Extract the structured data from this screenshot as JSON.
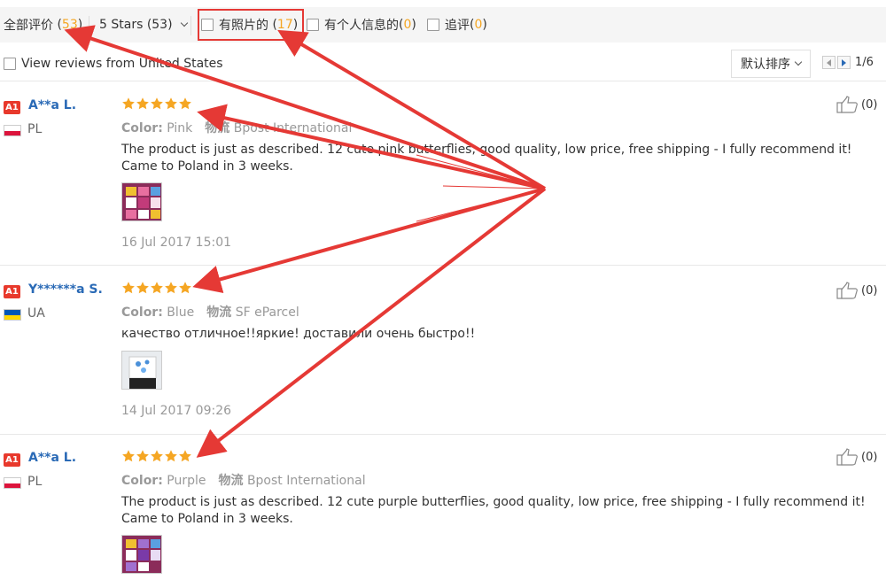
{
  "filters": {
    "all_label": "全部评价",
    "all_count": "53",
    "stars_label": "5 Stars (53)",
    "photo_label": "有照片的",
    "photo_count": "17",
    "personal_label": "有个人信息的",
    "personal_count": "0",
    "followup_label": "追评",
    "followup_count": "0"
  },
  "filter_row2": {
    "country_filter_label": "View reviews from United States",
    "sort_label": "默认排序",
    "pagination": "1/6"
  },
  "reviews": [
    {
      "level": "A1",
      "name": "A**a L.",
      "country": "PL",
      "flag_colors": [
        "#ffffff",
        "#dc143c"
      ],
      "rating": 5,
      "color_key": "Color:",
      "color_value": "Pink",
      "logistics_key": "物流",
      "logistics_value": "Bpost International",
      "text": "The product is just as described. 12 cute pink butterflies, good quality, low price, free shipping - I fully recommend it! Came to Poland in 3 weeks.",
      "date": "16 Jul 2017 15:01",
      "likes": "(0)"
    },
    {
      "level": "A1",
      "name": "Y******a S.",
      "country": "UA",
      "flag_colors": [
        "#0057b7",
        "#ffd700"
      ],
      "rating": 5,
      "color_key": "Color:",
      "color_value": "Blue",
      "logistics_key": "物流",
      "logistics_value": "SF eParcel",
      "text": "качество отличное!!яркие! доставили очень быстро!!",
      "date": "14 Jul 2017 09:26",
      "likes": "(0)"
    },
    {
      "level": "A1",
      "name": "A**a L.",
      "country": "PL",
      "flag_colors": [
        "#ffffff",
        "#dc143c"
      ],
      "rating": 5,
      "color_key": "Color:",
      "color_value": "Purple",
      "logistics_key": "物流",
      "logistics_value": "Bpost International",
      "text": "The product is just as described. 12 cute purple butterflies, good quality, low price, free shipping - I fully recommend it! Came to Poland in 3 weeks.",
      "date": "",
      "likes": "(0)"
    }
  ],
  "theme": {
    "accent_orange": "#f5a623",
    "link_blue": "#2a6ab6",
    "annotation_red": "#e53935"
  }
}
